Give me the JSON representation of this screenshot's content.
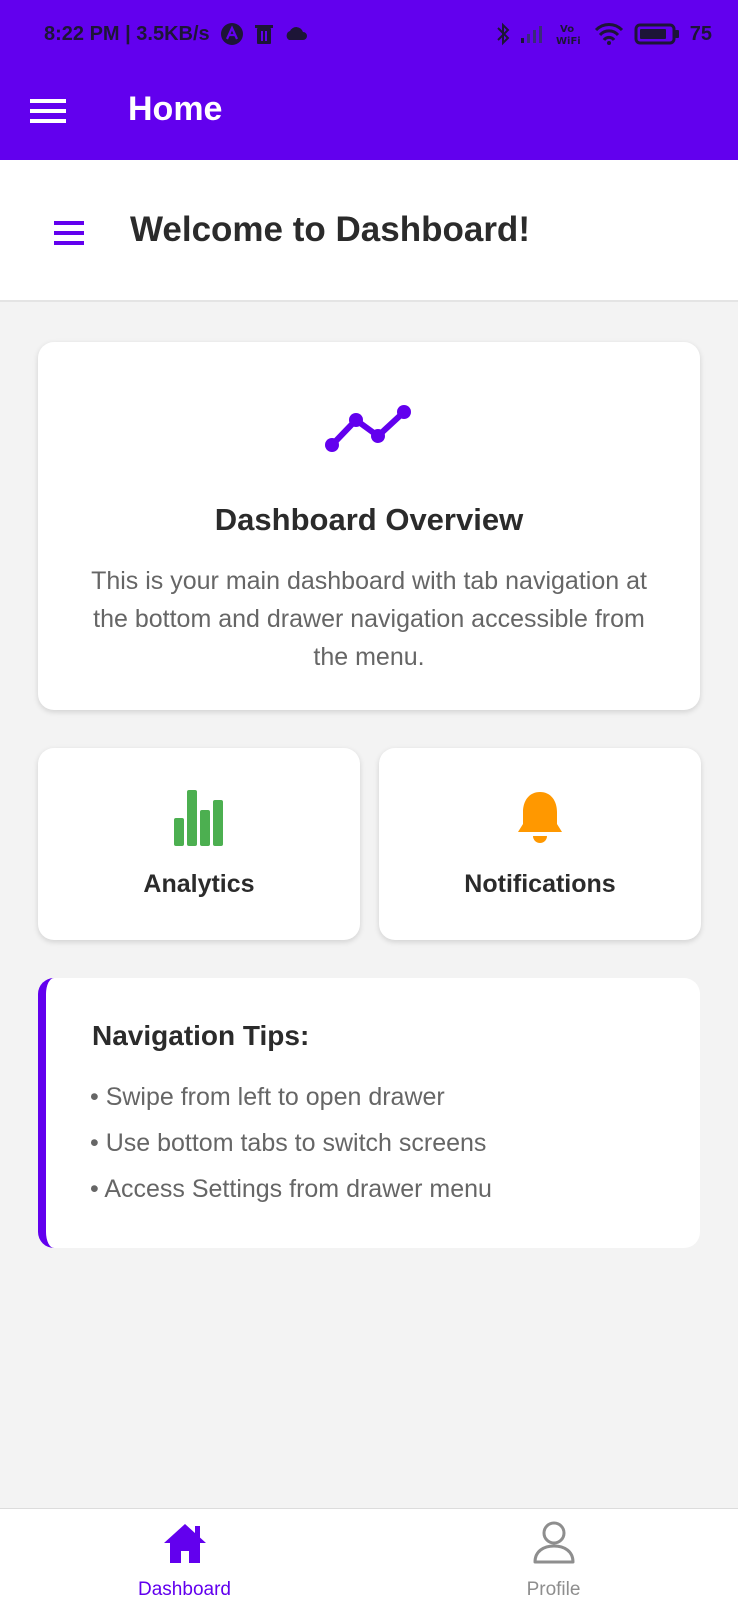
{
  "status_bar": {
    "time_and_speed": "8:22 PM | 3.5KB/s",
    "battery": "75"
  },
  "app_bar": {
    "title": "Home",
    "menu_icon": "hamburger-menu-icon",
    "color": "#6200ee"
  },
  "header": {
    "title": "Welcome to Dashboard!",
    "menu_icon": "hamburger-menu-icon"
  },
  "overview_card": {
    "icon": "trending-line-icon",
    "title": "Dashboard Overview",
    "description": "This is your main dashboard with tab navigation at the bottom and drawer navigation accessible from the menu."
  },
  "tiles": [
    {
      "label": "Analytics",
      "icon": "bar-chart-icon",
      "color": "#4caf50"
    },
    {
      "label": "Notifications",
      "icon": "bell-icon",
      "color": "#ff9800"
    }
  ],
  "tips": {
    "title": "Navigation Tips:",
    "items": [
      "• Swipe from left to open drawer",
      "• Use bottom tabs to switch screens",
      "• Access Settings from drawer menu"
    ]
  },
  "bottom_tabs": [
    {
      "label": "Dashboard",
      "icon": "home-icon",
      "active": true,
      "color": "#6200ee"
    },
    {
      "label": "Profile",
      "icon": "person-icon",
      "active": false,
      "color": "#8e8e8e"
    }
  ]
}
